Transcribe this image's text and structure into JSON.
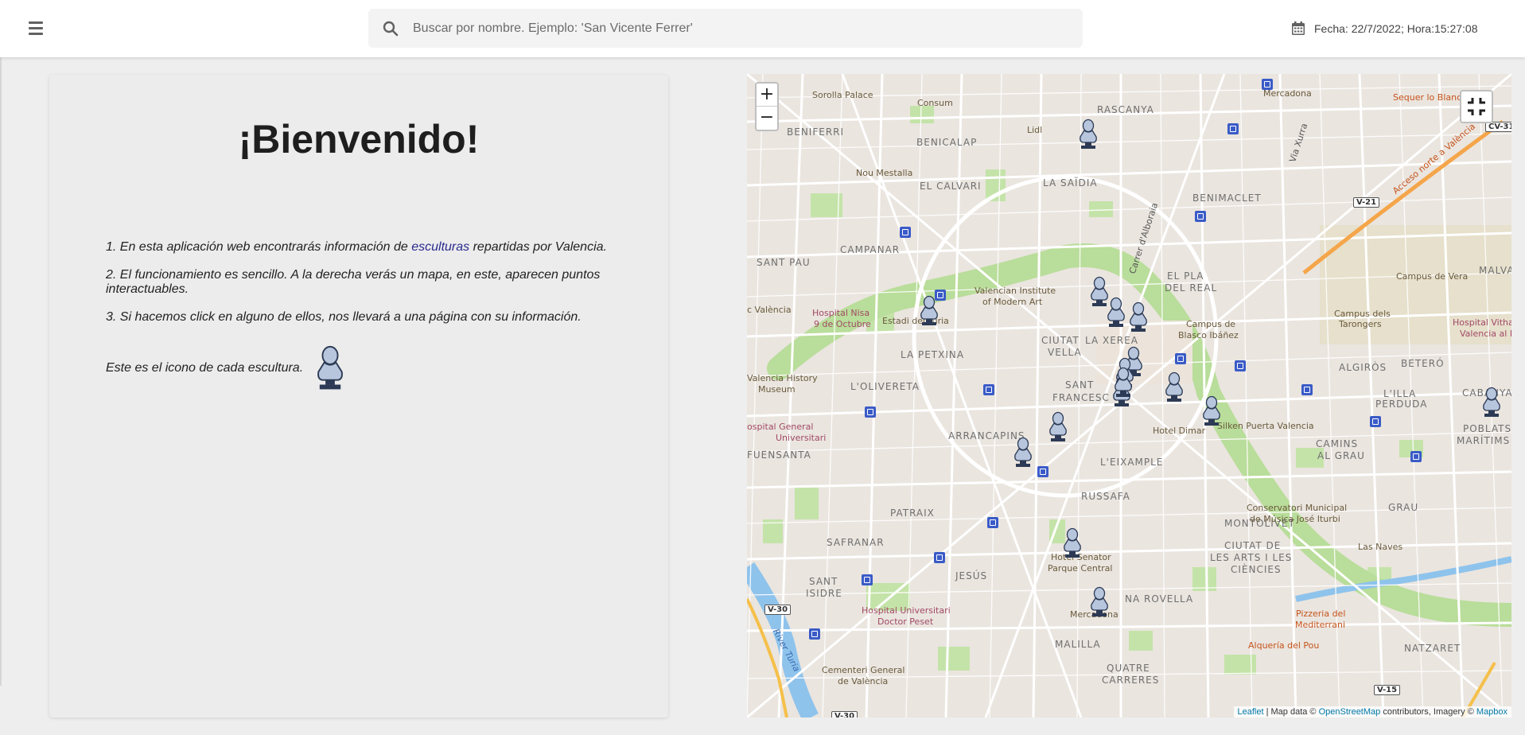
{
  "header": {
    "menu_icon": "hamburger-menu-icon",
    "search_placeholder": "Buscar por nombre. Ejemplo: 'San Vicente Ferrer'",
    "search_value": "",
    "datetime": "Fecha: 22/7/2022; Hora:15:27:08"
  },
  "welcome": {
    "title": "¡Bienvenido!",
    "item1_before": "1. En esta aplicación web encontrarás información de ",
    "item1_link": "esculturas",
    "item1_after": " repartidas por Valencia.",
    "item2": "2. El funcionamiento es sencillo. A la derecha verás un mapa, en este, aparecen puntos interactuables.",
    "item3": "3. Si hacemos click en alguno de ellos, nos llevará a una página con su información.",
    "icon_caption": "Este es el icono de cada escultura."
  },
  "map": {
    "zoom_in": "+",
    "zoom_out": "−",
    "attribution": {
      "leaflet": "Leaflet",
      "sep1": " | Map data © ",
      "osm": "OpenStreetMap",
      "mid": " contributors, Imagery © ",
      "mapbox": "Mapbox"
    },
    "districts": [
      "RASCANYA",
      "BENIFERRI",
      "BENICALAP",
      "EL CALVARI",
      "LA SAÏDIA",
      "BENIMACLET",
      "CAMPANAR",
      "SANT PAU",
      "EL PLA",
      "DEL REAL",
      "CIUTAT",
      "VELLA",
      "LA XEREA",
      "LA PETXINA",
      "L'OLIVERETA",
      "SANT",
      "FRANCESC",
      "ALGIRÒS",
      "BETERÓ",
      "L'ILLA",
      "PERDUDA",
      "CABANYAL",
      "ARRANCAPINS",
      "L'EIXAMPLE",
      "CAMINS",
      "AL GRAU",
      "POBLATS",
      "MARÍTIMS",
      "FUENSANTA",
      "RUSSAFA",
      "MONTOLIVET",
      "GRAU",
      "PATRAIX",
      "SAFRANAR",
      "CIUTAT DE",
      "LES ARTS I LES",
      "CIÈNCIES",
      "SANT",
      "ISIDRE",
      "JESÚS",
      "NA ROVELLA",
      "MALILLA",
      "QUATRE",
      "CARRERES",
      "NATZARET",
      "MALVA"
    ],
    "places": [
      "Sorolla Palace",
      "Consum",
      "Mercadona",
      "Sequer lo Blanch",
      "Lidl",
      "Nou Mestalla",
      "Valencian Institute",
      "of Modern Art",
      "Estadi del Túria",
      "Campus de Vera",
      "Campus dels",
      "Tarongers",
      "Campus de",
      "Blasco Ibáñez",
      "Valencia History",
      "Museum",
      "Hotel Dimar",
      "Silken Puerta Valencia",
      "Conservatori Municipal",
      "de Música José Iturbi",
      "Las Naves",
      "Hotel Senator",
      "Parque Central",
      "Mercadona",
      "Cementeri General",
      "de València",
      "c València"
    ],
    "hospitals": [
      "Hospital Nisa",
      "9 de Octubre",
      "Hospital General",
      "Universitari",
      "Hospital Universitari",
      "Doctor Peset",
      "Hospital Vithas",
      "Valencia al Mar",
      "ospital General"
    ],
    "food": [
      "Pizzeria del",
      "Mediterrani",
      "Alquería del Pou"
    ],
    "roads": [
      "V-21",
      "V-30",
      "V-15",
      "CV-31",
      "V-30"
    ],
    "streets": [
      "Carrer d'Alboraia",
      "Via Xurra",
      "Acceso norte a València",
      "River Turia"
    ],
    "sculpture_count": 17
  }
}
